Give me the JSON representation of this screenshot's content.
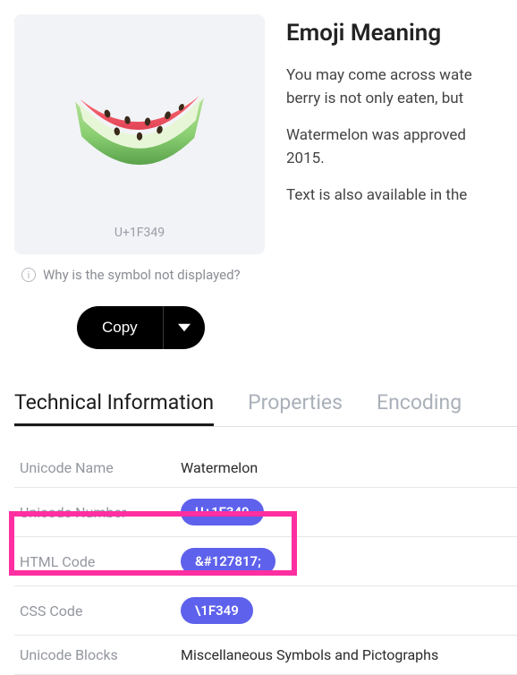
{
  "emoji": {
    "codepoint": "U+1F349",
    "icon_name": "watermelon-icon"
  },
  "why_link": "Why is the symbol not displayed?",
  "copy_label": "Copy",
  "meaning": {
    "heading": "Emoji Meaning",
    "p1": "You may come across wate",
    "p2": "berry is not only eaten, but ",
    "p3": "Watermelon was approved",
    "p4": "2015.",
    "p5": "Text is also available in the"
  },
  "tabs": {
    "technical": "Technical Information",
    "properties": "Properties",
    "encoding": "Encoding"
  },
  "table": {
    "r1_label": "Unicode Name",
    "r1_value": "Watermelon",
    "r2_label": "Unicode Number",
    "r2_pill": "U+1F349",
    "r3_label": "HTML Code",
    "r3_pill": "&#127817;",
    "r4_label": "CSS Code",
    "r4_pill": "\\1F349",
    "r5_label": "Unicode Blocks",
    "r5_value": "Miscellaneous Symbols and Pictographs"
  }
}
